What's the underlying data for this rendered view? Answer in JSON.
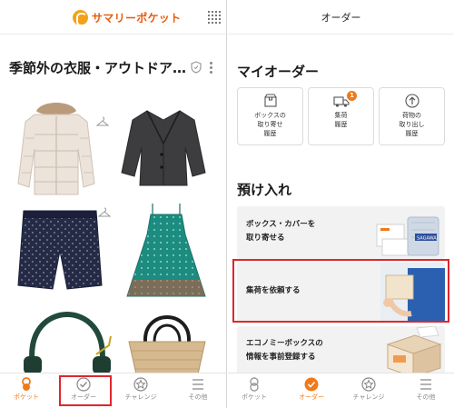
{
  "left": {
    "logo": "サマリーポケット",
    "title": "季節外の衣服・アウトドア…",
    "items": [
      {
        "name": "down-jacket"
      },
      {
        "name": "blazer"
      },
      {
        "name": "shorts"
      },
      {
        "name": "dress"
      },
      {
        "name": "headphones"
      },
      {
        "name": "basket-bag"
      }
    ],
    "tabs": [
      {
        "label": "ポケット",
        "icon": "pocket-icon",
        "active": true
      },
      {
        "label": "オーダー",
        "icon": "check-circle-icon",
        "active": false
      },
      {
        "label": "チャレンジ",
        "icon": "star-badge-icon",
        "active": false
      },
      {
        "label": "その他",
        "icon": "menu-icon",
        "active": false
      }
    ]
  },
  "right": {
    "header": "オーダー",
    "my_order_title": "マイオーダー",
    "order_cards": [
      {
        "label": "ボックスの\n取り寄せ\n履歴",
        "icon": "box-icon"
      },
      {
        "label": "集荷\n履歴",
        "icon": "truck-icon",
        "badge": "1"
      },
      {
        "label": "荷物の\n取り出し\n履歴",
        "icon": "upload-icon"
      }
    ],
    "deposit_title": "預け入れ",
    "deposit_cards": [
      {
        "label": "ボックス・カバーを\n取り寄せる"
      },
      {
        "label": "集荷を依頼する"
      },
      {
        "label": "エコノミーボックスの\n情報を事前登録する"
      }
    ],
    "tabs": [
      {
        "label": "ポケット",
        "icon": "pocket-icon",
        "active": false
      },
      {
        "label": "オーダー",
        "icon": "check-circle-icon",
        "active": true
      },
      {
        "label": "チャレンジ",
        "icon": "star-badge-icon",
        "active": false
      },
      {
        "label": "その他",
        "icon": "menu-icon",
        "active": false
      }
    ]
  },
  "colors": {
    "accent": "#f07a1a",
    "highlight": "#e0262b"
  }
}
